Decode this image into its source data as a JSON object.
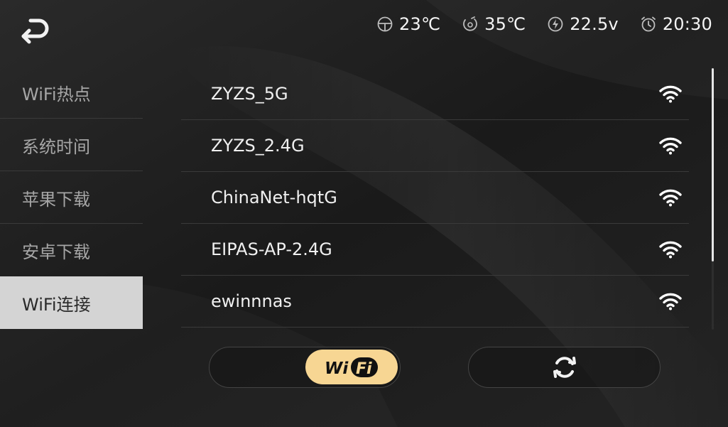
{
  "status": {
    "cabin_temp": "23℃",
    "motor_temp": "35℃",
    "voltage": "22.5v",
    "time": "20:30"
  },
  "sidebar": {
    "items": [
      {
        "label": "WiFi热点",
        "active": false
      },
      {
        "label": "系统时间",
        "active": false
      },
      {
        "label": "苹果下载",
        "active": false
      },
      {
        "label": "安卓下载",
        "active": false
      },
      {
        "label": "WiFi连接",
        "active": true
      }
    ]
  },
  "wifi_list": {
    "networks": [
      {
        "ssid": "ZYZS_5G",
        "signal_icon": "wifi-signal-icon"
      },
      {
        "ssid": "ZYZS_2.4G",
        "signal_icon": "wifi-signal-icon"
      },
      {
        "ssid": "ChinaNet-hqtG",
        "signal_icon": "wifi-signal-icon"
      },
      {
        "ssid": "EIPAS-AP-2.4G",
        "signal_icon": "wifi-signal-icon"
      },
      {
        "ssid": "ewinnnas",
        "signal_icon": "wifi-signal-icon"
      }
    ]
  },
  "controls": {
    "wifi_toggle_logo": "WiFi",
    "wifi_enabled": true,
    "refresh_icon": "refresh-icon"
  },
  "colors": {
    "background": "#1b1b1b",
    "active_item_bg": "#d4d4d4",
    "wifi_badge": "#f7d693",
    "text": "#f0f0f0",
    "muted_text": "#a6a6a6"
  }
}
